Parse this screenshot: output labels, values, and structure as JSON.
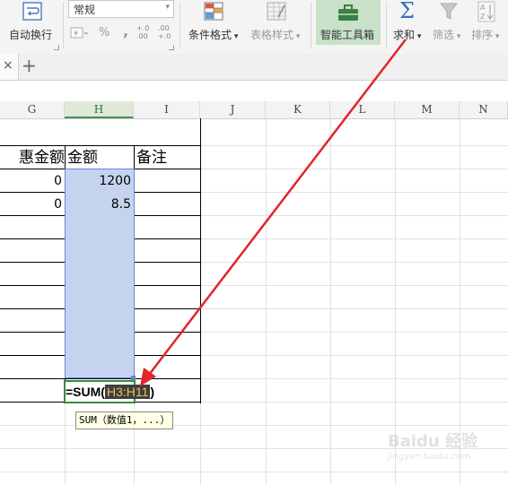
{
  "ribbon": {
    "wrap_label": "自动换行",
    "number_format_value": "常规",
    "percent_symbol": "%",
    "thousands_symbol": ",",
    "inc_decimal_label": "+.0\n.00",
    "dec_decimal_label": ".00\n+.0",
    "conditional_format_label": "条件格式",
    "table_style_label": "表格样式",
    "smart_toolbox_label": "智能工具箱",
    "sum_label": "求和",
    "filter_label": "筛选",
    "sort_label": "排序",
    "accent": "#217346"
  },
  "tabs": {
    "close_symbol": "×",
    "add_symbol": "+"
  },
  "sheet": {
    "columns": [
      "G",
      "H",
      "I",
      "J",
      "K",
      "L",
      "M",
      "N"
    ],
    "header_row": {
      "g": "惠金额",
      "h": "金额",
      "i": "备注"
    },
    "rows": [
      {
        "g": "0",
        "h": "1200"
      },
      {
        "g": "0",
        "h": "8.5"
      }
    ],
    "formula": {
      "prefix": "=SUM(",
      "range": "H3:H11",
      "suffix": ")"
    },
    "tooltip": "SUM（数值1，...）",
    "selection_color": "#c5d3ef",
    "selection_border": "#5b8bd8"
  },
  "watermark": {
    "brand": "Baidu 经验",
    "sub": "jingyan.baidu.com"
  },
  "annotation": {
    "arrow_color": "#e0252b"
  }
}
